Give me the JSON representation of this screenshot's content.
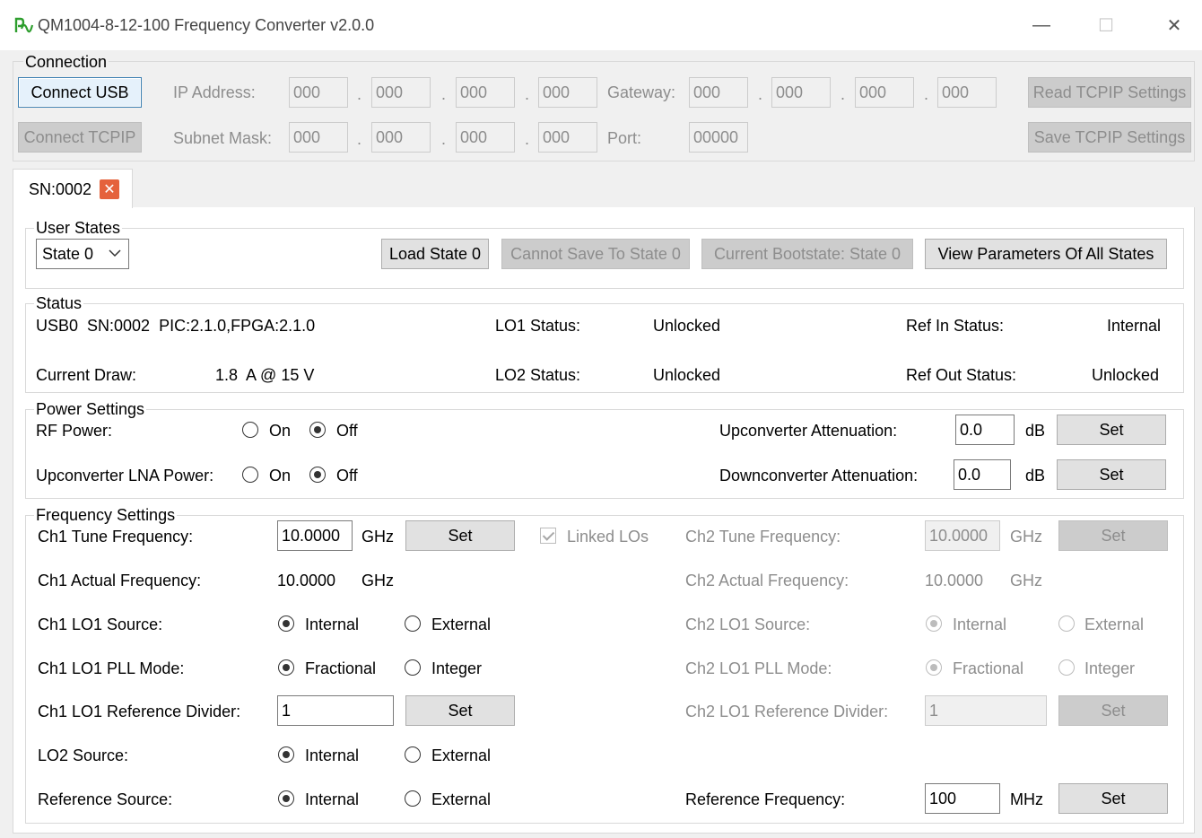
{
  "window": {
    "title": "QM1004-8-12-100 Frequency Converter v2.0.0",
    "minimize_glyph": "—",
    "maximize_glyph": "☐",
    "close_glyph": "✕"
  },
  "connection": {
    "group_label": "Connection",
    "connect_usb": "Connect USB",
    "connect_tcpip": "Connect TCPIP",
    "ip_label": "IP Address:",
    "ip": [
      "000",
      "000",
      "000",
      "000"
    ],
    "gateway_label": "Gateway:",
    "gateway": [
      "000",
      "000",
      "000",
      "000"
    ],
    "subnet_label": "Subnet Mask:",
    "subnet": [
      "000",
      "000",
      "000",
      "000"
    ],
    "port_label": "Port:",
    "port": "00000",
    "dot": ".",
    "read_tcpip": "Read TCPIP Settings",
    "save_tcpip": "Save TCPIP Settings"
  },
  "tab": {
    "label": "SN:0002",
    "close_glyph": "✕"
  },
  "user_states": {
    "group_label": "User States",
    "selected_state": "State 0",
    "load": "Load State 0",
    "cannot_save": "Cannot Save To State 0",
    "bootstate": "Current Bootstate: State 0",
    "view_all": "View Parameters Of All States"
  },
  "status": {
    "group_label": "Status",
    "device_info": "USB0  SN:0002  PIC:2.1.0,FPGA:2.1.0",
    "current_draw_label": "Current Draw:",
    "current_draw_value": "1.8  A @ 15 V",
    "lo1_label": "LO1 Status:",
    "lo1_value": "Unlocked",
    "lo2_label": "LO2 Status:",
    "lo2_value": "Unlocked",
    "ref_in_label": "Ref In Status:",
    "ref_in_value": "Internal",
    "ref_out_label": "Ref Out Status:",
    "ref_out_value": "Unlocked"
  },
  "power": {
    "group_label": "Power Settings",
    "rf_power_label": "RF Power:",
    "lna_power_label": "Upconverter LNA Power:",
    "on": "On",
    "off": "Off",
    "up_atten_label": "Upconverter Attenuation:",
    "up_atten_value": "0.0",
    "down_atten_label": "Downconverter Attenuation:",
    "down_atten_value": "0.0",
    "db": "dB",
    "set": "Set"
  },
  "freq": {
    "group_label": "Frequency Settings",
    "ch1_tune_label": "Ch1 Tune Frequency:",
    "ch1_tune_value": "10.0000",
    "ghz": "GHz",
    "mhz": "MHz",
    "set": "Set",
    "linked_los": "Linked LOs",
    "ch2_tune_label": "Ch2 Tune Frequency:",
    "ch2_tune_value": "10.0000",
    "ch1_actual_label": "Ch1 Actual Frequency:",
    "ch1_actual_value": "10.0000",
    "ch2_actual_label": "Ch2 Actual Frequency:",
    "ch2_actual_value": "10.0000",
    "ch1_lo1_source_label": "Ch1 LO1 Source:",
    "ch2_lo1_source_label": "Ch2 LO1 Source:",
    "internal": "Internal",
    "external": "External",
    "ch1_pll_label": "Ch1 LO1 PLL Mode:",
    "ch2_pll_label": "Ch2 LO1 PLL Mode:",
    "fractional": "Fractional",
    "integer": "Integer",
    "ch1_refdiv_label": "Ch1 LO1 Reference Divider:",
    "ch1_refdiv_value": "1",
    "ch2_refdiv_label": "Ch2 LO1 Reference Divider:",
    "ch2_refdiv_value": "1",
    "lo2_source_label": "LO2 Source:",
    "ref_source_label": "Reference Source:",
    "ref_freq_label": "Reference Frequency:",
    "ref_freq_value": "100"
  },
  "colors": {
    "window_bg": "#f0f0f0",
    "page_bg": "#ffffff",
    "disabled_text": "#8d8d8d",
    "close_badge": "#e5623c",
    "icon_green": "#2e9e2e"
  },
  "icons": [
    "app-logo-icon",
    "minimize-icon",
    "maximize-icon",
    "close-icon",
    "tab-close-icon",
    "chevron-down-icon"
  ]
}
